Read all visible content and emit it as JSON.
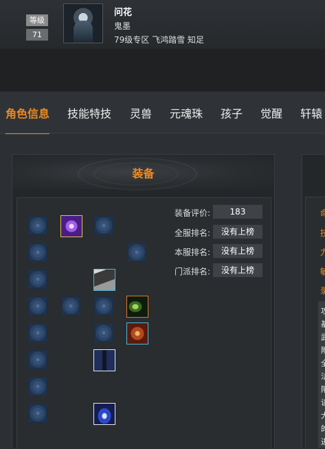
{
  "header": {
    "level_label": "等级",
    "level_value": "71",
    "character_name": "问花",
    "character_class": "鬼墨",
    "server_info": "79级专区 飞鸿踏雪 知足"
  },
  "tabs": [
    {
      "label": "角色信息",
      "active": true
    },
    {
      "label": "技能特技",
      "active": false
    },
    {
      "label": "灵兽",
      "active": false
    },
    {
      "label": "元魂珠",
      "active": false
    },
    {
      "label": "孩子",
      "active": false
    },
    {
      "label": "觉醒",
      "active": false
    },
    {
      "label": "轩辕",
      "active": false
    }
  ],
  "equipment": {
    "title": "装备",
    "stats": [
      {
        "label": "装备评价:",
        "value": "183"
      },
      {
        "label": "全服排名:",
        "value": "没有上榜"
      },
      {
        "label": "本服排名:",
        "value": "没有上榜"
      },
      {
        "label": "门派排名:",
        "value": "没有上榜"
      }
    ]
  },
  "right_panel": {
    "labels": [
      "命",
      "技",
      "力",
      "敏",
      "录"
    ],
    "text_fragments": [
      "攻",
      "基",
      "武",
      "附",
      "全",
      "法",
      "阳",
      "读",
      "大",
      "的",
      "进"
    ]
  },
  "colors": {
    "accent": "#ee8a22",
    "background": "#2c3034",
    "panel": "#24272a",
    "value_box": "#3f4347"
  }
}
